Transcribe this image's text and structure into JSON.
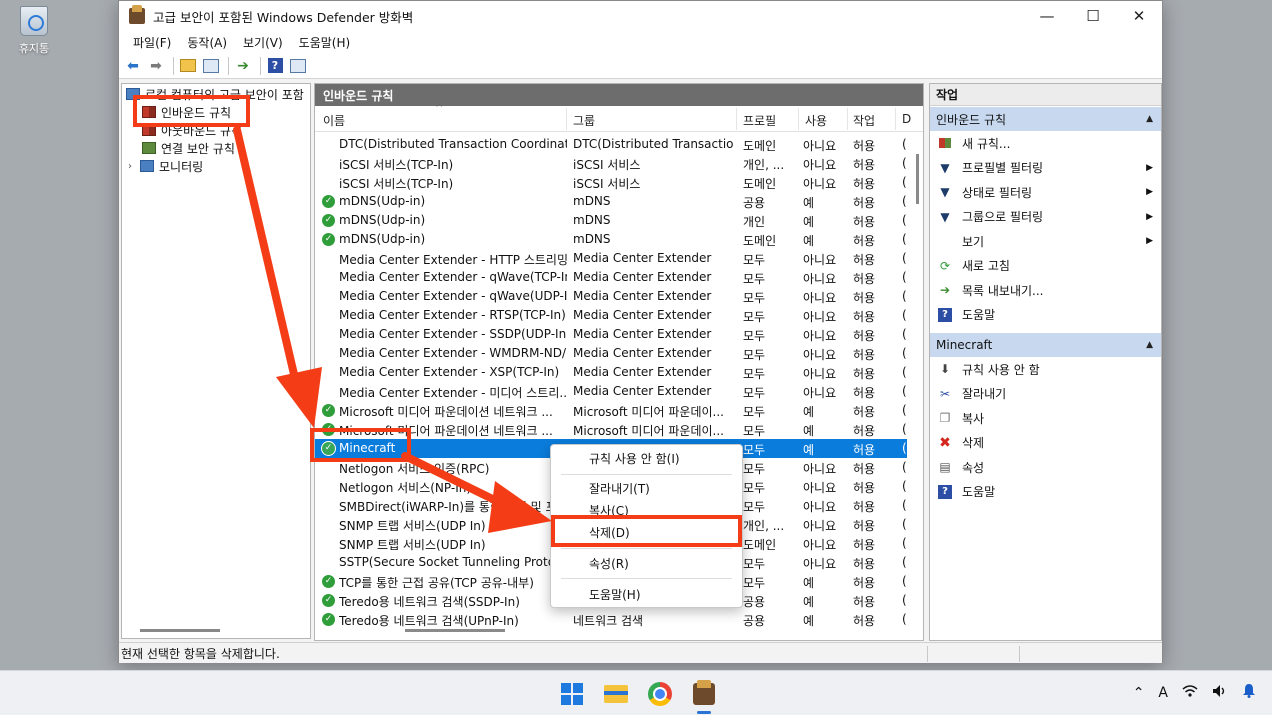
{
  "desktop": {
    "recycle_bin_label": "휴지통"
  },
  "window": {
    "title": "고급 보안이 포함된 Windows Defender 방화벽",
    "controls": {
      "minimize": "—",
      "maximize": "☐",
      "close": "✕"
    }
  },
  "menu": {
    "file": "파일(F)",
    "action": "동작(A)",
    "view": "보기(V)",
    "help": "도움말(H)"
  },
  "tree": {
    "root": "로컬 컴퓨터의 고급 보안이 포함",
    "inbound": "인바운드 규칙",
    "outbound": "아웃바운드 규칙",
    "connection_security": "연결 보안 규칙",
    "monitoring": "모니터링"
  },
  "center": {
    "header": "인바운드 규칙",
    "columns": {
      "name": "이름",
      "group": "그룹",
      "profile": "프로필",
      "enabled": "사용",
      "action": "작업",
      "override": "D"
    },
    "rows": [
      {
        "check": false,
        "name": "DTC(Distributed Transaction Coordinato...",
        "group": "DTC(Distributed Transactio...",
        "profile": "도메인",
        "enabled": "아니요",
        "action": "허용",
        "d": "("
      },
      {
        "check": false,
        "name": "iSCSI 서비스(TCP-In)",
        "group": "iSCSI 서비스",
        "profile": "개인, ...",
        "enabled": "아니요",
        "action": "허용",
        "d": "("
      },
      {
        "check": false,
        "name": "iSCSI 서비스(TCP-In)",
        "group": "iSCSI 서비스",
        "profile": "도메인",
        "enabled": "아니요",
        "action": "허용",
        "d": "("
      },
      {
        "check": true,
        "name": "mDNS(Udp-in)",
        "group": "mDNS",
        "profile": "공용",
        "enabled": "예",
        "action": "허용",
        "d": "("
      },
      {
        "check": true,
        "name": "mDNS(Udp-in)",
        "group": "mDNS",
        "profile": "개인",
        "enabled": "예",
        "action": "허용",
        "d": "("
      },
      {
        "check": true,
        "name": "mDNS(Udp-in)",
        "group": "mDNS",
        "profile": "도메인",
        "enabled": "예",
        "action": "허용",
        "d": "("
      },
      {
        "check": false,
        "name": "Media Center Extender - HTTP 스트리밍...",
        "group": "Media Center Extender",
        "profile": "모두",
        "enabled": "아니요",
        "action": "허용",
        "d": "("
      },
      {
        "check": false,
        "name": "Media Center Extender - qWave(TCP-In)",
        "group": "Media Center Extender",
        "profile": "모두",
        "enabled": "아니요",
        "action": "허용",
        "d": "("
      },
      {
        "check": false,
        "name": "Media Center Extender - qWave(UDP-In)",
        "group": "Media Center Extender",
        "profile": "모두",
        "enabled": "아니요",
        "action": "허용",
        "d": "("
      },
      {
        "check": false,
        "name": "Media Center Extender - RTSP(TCP-In)",
        "group": "Media Center Extender",
        "profile": "모두",
        "enabled": "아니요",
        "action": "허용",
        "d": "("
      },
      {
        "check": false,
        "name": "Media Center Extender - SSDP(UDP-In)",
        "group": "Media Center Extender",
        "profile": "모두",
        "enabled": "아니요",
        "action": "허용",
        "d": "("
      },
      {
        "check": false,
        "name": "Media Center Extender - WMDRM-ND/...",
        "group": "Media Center Extender",
        "profile": "모두",
        "enabled": "아니요",
        "action": "허용",
        "d": "("
      },
      {
        "check": false,
        "name": "Media Center Extender - XSP(TCP-In)",
        "group": "Media Center Extender",
        "profile": "모두",
        "enabled": "아니요",
        "action": "허용",
        "d": "("
      },
      {
        "check": false,
        "name": "Media Center Extender - 미디어 스트리...",
        "group": "Media Center Extender",
        "profile": "모두",
        "enabled": "아니요",
        "action": "허용",
        "d": "("
      },
      {
        "check": true,
        "name": "Microsoft 미디어 파운데이션 네트워크 ...",
        "group": "Microsoft 미디어 파운데이...",
        "profile": "모두",
        "enabled": "예",
        "action": "허용",
        "d": "("
      },
      {
        "check": true,
        "name": "Microsoft 미디어 파운데이션 네트워크 ...",
        "group": "Microsoft 미디어 파운데이...",
        "profile": "모두",
        "enabled": "예",
        "action": "허용",
        "d": "("
      },
      {
        "check": true,
        "selected": true,
        "name": "Minecraft",
        "group": "",
        "profile": "모두",
        "enabled": "예",
        "action": "허용",
        "d": "("
      },
      {
        "check": false,
        "name": "Netlogon 서비스 인증(RPC)",
        "group": "",
        "profile": "모두",
        "enabled": "아니요",
        "action": "허용",
        "d": "("
      },
      {
        "check": false,
        "name": "Netlogon 서비스(NP-In)",
        "group": "",
        "profile": "모두",
        "enabled": "아니요",
        "action": "허용",
        "d": "("
      },
      {
        "check": false,
        "name": "SMBDirect(iWARP-In)를 통한 파일 및 프린",
        "group": "",
        "profile": "모두",
        "enabled": "아니요",
        "action": "허용",
        "d": "("
      },
      {
        "check": false,
        "name": "SNMP 트랩 서비스(UDP In)",
        "group": "",
        "profile": "개인, ...",
        "enabled": "아니요",
        "action": "허용",
        "d": "("
      },
      {
        "check": false,
        "name": "SNMP 트랩 서비스(UDP In)",
        "group": "",
        "profile": "도메인",
        "enabled": "아니요",
        "action": "허용",
        "d": "("
      },
      {
        "check": false,
        "name": "SSTP(Secure Socket Tunneling Protocol",
        "group": "",
        "profile": "모두",
        "enabled": "아니요",
        "action": "허용",
        "d": "("
      },
      {
        "check": true,
        "name": "TCP를 통한 근접 공유(TCP 공유-내부)",
        "group": "",
        "profile": "모두",
        "enabled": "예",
        "action": "허용",
        "d": "("
      },
      {
        "check": true,
        "name": "Teredo용 네트워크 검색(SSDP-In)",
        "group": "",
        "profile": "공용",
        "enabled": "예",
        "action": "허용",
        "d": "("
      },
      {
        "check": true,
        "name": "Teredo용 네트워크 검색(UPnP-In)",
        "group": "네트워크 검색",
        "profile": "공용",
        "enabled": "예",
        "action": "허용",
        "d": "("
      }
    ]
  },
  "actions": {
    "title": "작업",
    "section1": {
      "title": "인바운드 규칙",
      "items": [
        "새 규칙...",
        "프로필별 필터링",
        "상태로 필터링",
        "그룹으로 필터링",
        "보기",
        "새로 고침",
        "목록 내보내기...",
        "도움말"
      ]
    },
    "section2": {
      "title": "Minecraft",
      "items": [
        "규칙 사용 안 함",
        "잘라내기",
        "복사",
        "삭제",
        "속성",
        "도움말"
      ]
    }
  },
  "context_menu": {
    "disable": "규칙 사용 안 함(I)",
    "cut": "잘라내기(T)",
    "copy": "복사(C)",
    "delete": "삭제(D)",
    "properties": "속성(R)",
    "help": "도움말(H)"
  },
  "status": {
    "text": "현재 선택한 항목을 삭제합니다."
  },
  "taskbar": {
    "apps": [
      "start-icon",
      "file-explorer-icon",
      "chrome-icon",
      "defender-firewall-icon"
    ],
    "tray": {
      "chevron": "⌃",
      "ime": "A",
      "wifi": "wifi-icon",
      "volume": "volume-icon",
      "bell": "bell-icon"
    }
  },
  "colors": {
    "selection": "#0a7cdb",
    "annotation": "#f43d17",
    "action_header": "#c8d9ef"
  }
}
